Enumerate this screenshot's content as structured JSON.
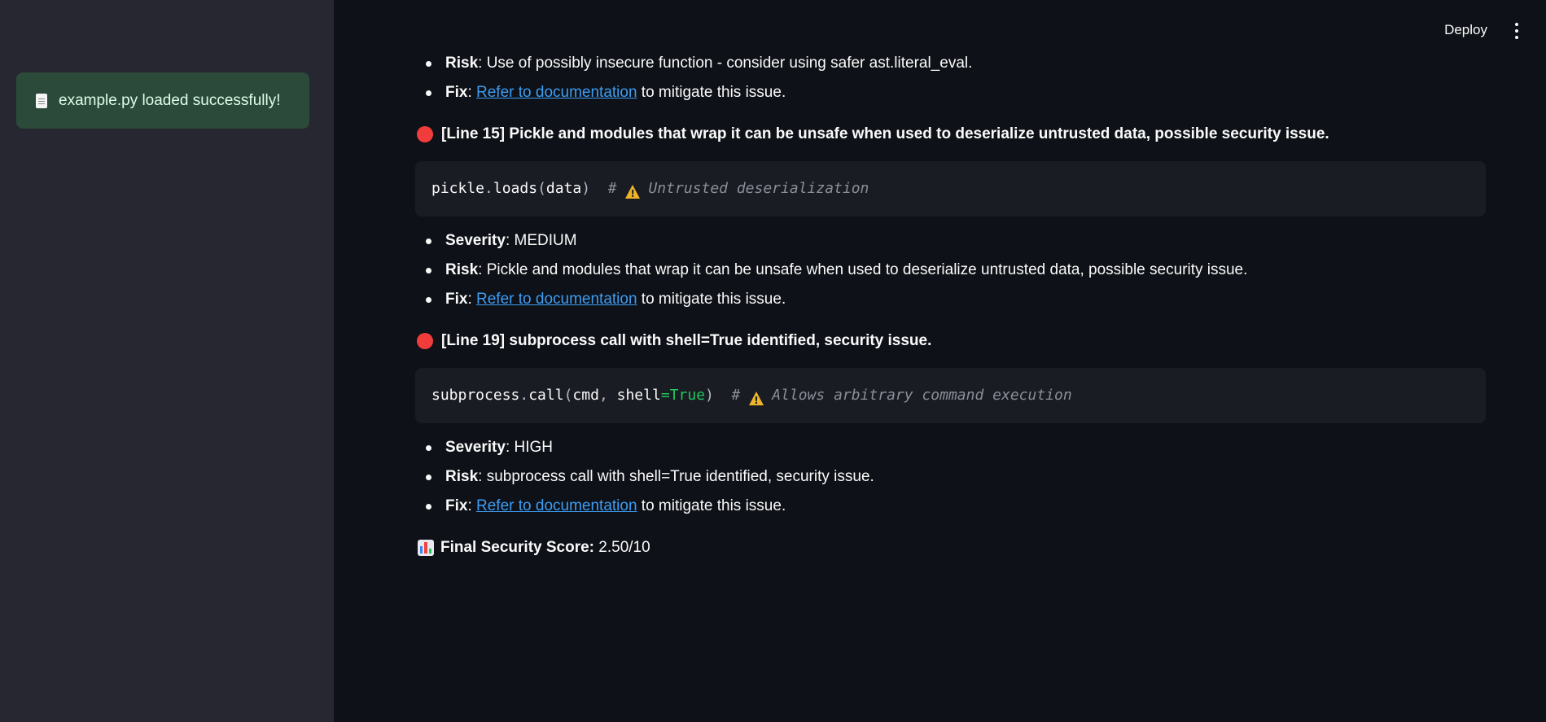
{
  "sidebar": {
    "toast": {
      "icon": "document-icon",
      "text": "example.py loaded successfully!"
    }
  },
  "header": {
    "deploy_label": "Deploy",
    "menu_icon": "vertical-dots-icon"
  },
  "findings": {
    "top": {
      "risk_label": "Risk",
      "risk_text": ": Use of possibly insecure function - consider using safer ast.literal_eval.",
      "fix_label": "Fix",
      "fix_link": "Refer to documentation",
      "fix_rest": " to mitigate this issue."
    },
    "issue_15": {
      "heading": "[Line 15] Pickle and modules that wrap it can be unsafe when used to deserialize untrusted data, possible security issue.",
      "code_obj": "pickle",
      "code_dot": ".",
      "code_fn": "loads",
      "code_open": "(",
      "code_arg": "data",
      "code_close": ")",
      "code_comment_hash": "  # ",
      "code_comment": "Untrusted deserialization",
      "severity_label": "Severity",
      "severity_value": ": MEDIUM",
      "risk_label": "Risk",
      "risk_text": ": Pickle and modules that wrap it can be unsafe when used to deserialize untrusted data, possible security issue.",
      "fix_label": "Fix",
      "fix_link": "Refer to documentation",
      "fix_rest": " to mitigate this issue."
    },
    "issue_19": {
      "heading": "[Line 19] subprocess call with shell=True identified, security issue.",
      "code_obj": "subprocess",
      "code_dot": ".",
      "code_fn": "call",
      "code_open": "(",
      "code_arg1": "cmd",
      "code_comma": ", ",
      "code_arg2": "shell",
      "code_eq": "=",
      "code_true": "True",
      "code_close": ")",
      "code_comment_hash": "  # ",
      "code_comment": "Allows arbitrary command execution",
      "severity_label": "Severity",
      "severity_value": ": HIGH",
      "risk_label": "Risk",
      "risk_text": ": subprocess call with shell=True identified, security issue.",
      "fix_label": "Fix",
      "fix_link": "Refer to documentation",
      "fix_rest": " to mitigate this issue."
    }
  },
  "score": {
    "icon": "bar-chart-icon",
    "label": "Final Security Score:",
    "value": " 2.50/10"
  },
  "colors": {
    "background": "#0e1117",
    "sidebar": "#262730",
    "toast": "#2b4a3a",
    "link": "#3d9df3",
    "alert_dot": "#f13c3c",
    "code_true": "#22c55e",
    "warning": "#f0b429"
  }
}
